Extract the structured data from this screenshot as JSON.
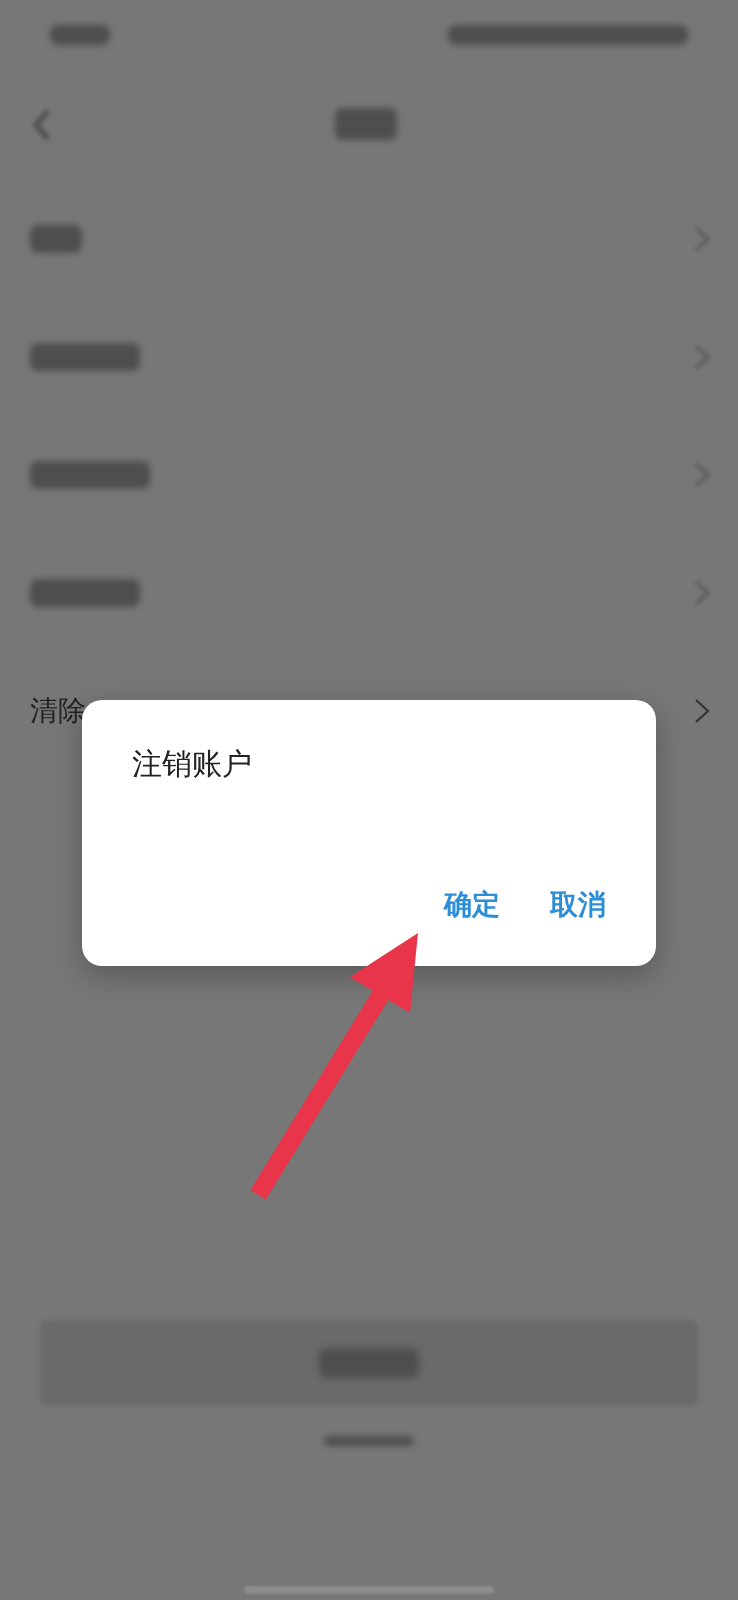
{
  "settings_list": {
    "items": [
      {
        "kind": "blurred"
      },
      {
        "kind": "blurred"
      },
      {
        "kind": "blurred"
      },
      {
        "kind": "blurred"
      },
      {
        "kind": "text",
        "label": "清除"
      }
    ]
  },
  "dialog": {
    "title": "注销账户",
    "buttons": [
      {
        "label": "确定"
      },
      {
        "label": "取消"
      }
    ]
  },
  "annotation": {
    "kind": "arrow"
  }
}
